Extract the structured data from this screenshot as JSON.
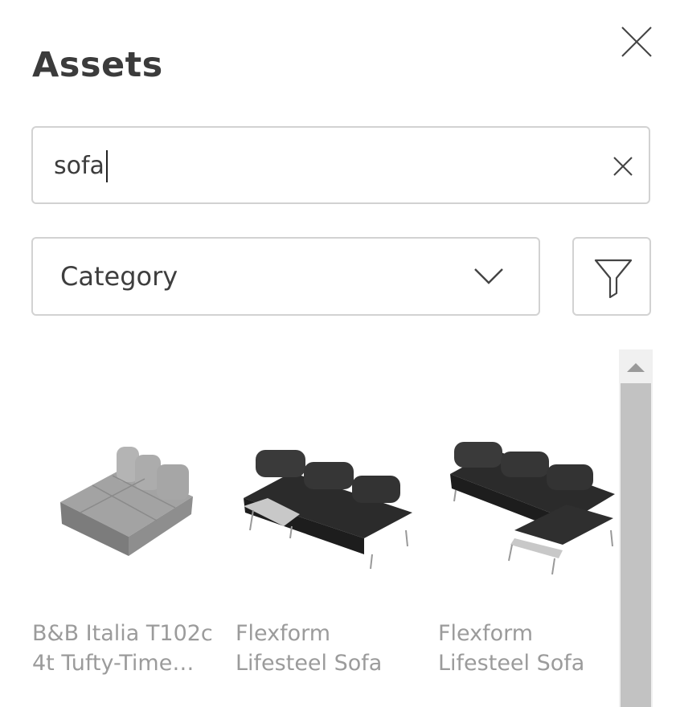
{
  "panel": {
    "title": "Assets",
    "close_icon": "close-icon"
  },
  "search": {
    "value": "sofa",
    "placeholder": "",
    "clear_icon": "clear-icon"
  },
  "category": {
    "label": "Category",
    "icon": "chevron-down-icon"
  },
  "filter": {
    "icon": "filter-icon"
  },
  "assets": [
    {
      "line1": "B&B Italia T102c",
      "line2": "4t Tufty-Time…",
      "color": "#9a9a9a"
    },
    {
      "line1": "Flexform",
      "line2": "Lifesteel Sofa",
      "color": "#2e2e2e"
    },
    {
      "line1": "Flexform",
      "line2": "Lifesteel Sofa",
      "color": "#2e2e2e"
    }
  ],
  "scrollbar": {
    "up_icon": "triangle-up-icon"
  }
}
